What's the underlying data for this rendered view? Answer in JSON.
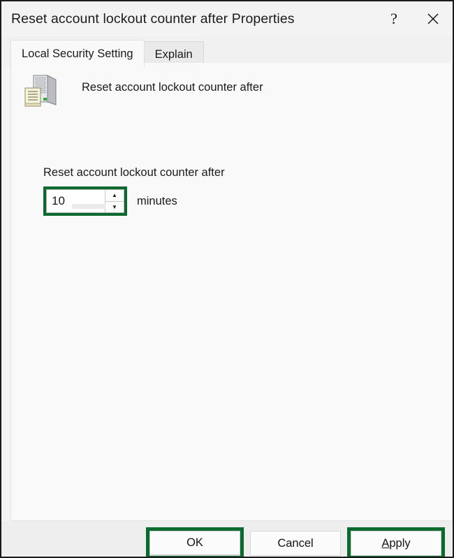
{
  "window": {
    "title": "Reset account lockout counter after Properties",
    "help_icon": "question-mark-icon",
    "help_glyph": "?",
    "close_icon": "close-icon"
  },
  "tabs": [
    {
      "label": "Local Security Setting",
      "active": true
    },
    {
      "label": "Explain",
      "active": false
    }
  ],
  "content": {
    "policy_icon": "computer-policy-icon",
    "policy_name": "Reset account lockout counter after",
    "setting": {
      "label": "Reset account lockout counter after",
      "value": "10",
      "units": "minutes",
      "spin_up_glyph": "▲",
      "spin_down_glyph": "▼",
      "spin_up_icon": "spinner-up-arrow-icon",
      "spin_down_icon": "spinner-down-arrow-icon",
      "highlighted": true
    }
  },
  "footer": {
    "buttons": [
      {
        "label": "OK",
        "default": true,
        "highlighted": true,
        "accelerator": ""
      },
      {
        "label": "Cancel",
        "default": false,
        "highlighted": false,
        "accelerator": ""
      },
      {
        "label": "Apply",
        "default": false,
        "highlighted": true,
        "accelerator": "A",
        "label_rest": "pply"
      }
    ]
  },
  "colors": {
    "highlight_green": "#0b6b2e",
    "default_button_underline": "#5d87b5",
    "titlebar_bg": "#f3f3f3",
    "content_bg": "#f9f9f9",
    "footer_bg": "#eeeeee",
    "window_border": "#1b1b1b"
  }
}
